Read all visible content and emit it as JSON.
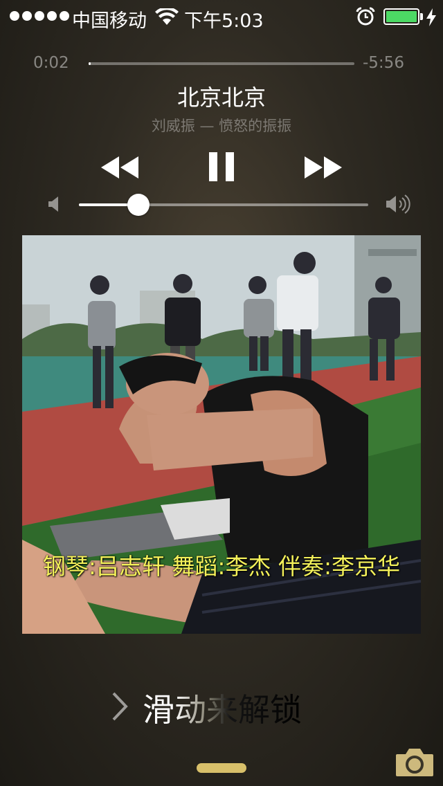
{
  "status_bar": {
    "carrier": "中国移动",
    "time": "下午5:03",
    "signal_dots": 5,
    "battery_color": "#4cd964",
    "icons": [
      "wifi-icon",
      "alarm-icon",
      "battery-icon",
      "charging-bolt-icon"
    ]
  },
  "player": {
    "elapsed": "0:02",
    "remaining": "-5:56",
    "progress_fraction": 0.006,
    "title": "北京北京",
    "artist_album": "刘威振 — 愤怒的振振",
    "controls": [
      "rewind-icon",
      "pause-icon",
      "fast-forward-icon"
    ],
    "volume_fraction": 0.205
  },
  "album_art": {
    "caption": "钢琴:吕志轩 舞蹈:李杰 伴奏:李京华"
  },
  "lock": {
    "slide_text": "滑动来解锁",
    "icons": [
      "chevron-right-icon",
      "camera-icon"
    ],
    "accent": "#d8c06a"
  }
}
